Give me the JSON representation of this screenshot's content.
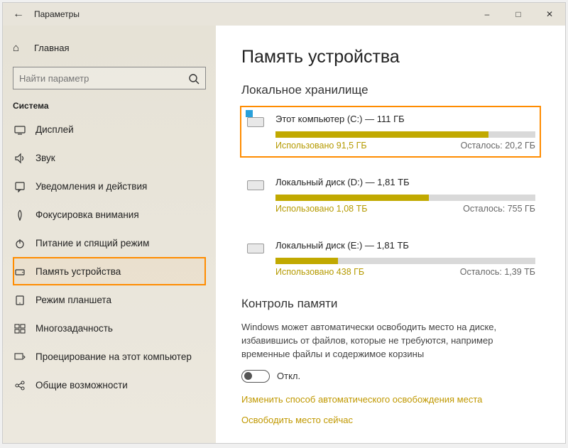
{
  "titlebar": {
    "title": "Параметры"
  },
  "sidebar": {
    "home": "Главная",
    "search_placeholder": "Найти параметр",
    "section": "Система",
    "items": [
      {
        "label": "Дисплей"
      },
      {
        "label": "Звук"
      },
      {
        "label": "Уведомления и действия"
      },
      {
        "label": "Фокусировка внимания"
      },
      {
        "label": "Питание и спящий режим"
      },
      {
        "label": "Память устройства"
      },
      {
        "label": "Режим планшета"
      },
      {
        "label": "Многозадачность"
      },
      {
        "label": "Проецирование на этот компьютер"
      },
      {
        "label": "Общие возможности"
      }
    ]
  },
  "main": {
    "title": "Память устройства",
    "local_heading": "Локальное хранилище",
    "drives": [
      {
        "title": "Этот компьютер (C:) — 111 ГБ",
        "used": "Использовано 91,5 ГБ",
        "free": "Осталось: 20,2 ГБ",
        "fill_pct": 82,
        "primary": true
      },
      {
        "title": "Локальный диск (D:) — 1,81 ТБ",
        "used": "Использовано 1,08 ТБ",
        "free": "Осталось: 755 ГБ",
        "fill_pct": 59,
        "primary": false
      },
      {
        "title": "Локальный диск (E:) — 1,81 ТБ",
        "used": "Использовано 438 ГБ",
        "free": "Осталось: 1,39 ТБ",
        "fill_pct": 24,
        "primary": false
      }
    ],
    "sense_heading": "Контроль памяти",
    "sense_desc": "Windows может автоматически освободить место на диске, избавившись от файлов, которые не требуются, например временные файлы и содержимое корзины",
    "toggle_label": "Откл.",
    "link1": "Изменить способ автоматического освобождения места",
    "link2": "Освободить место сейчас"
  }
}
